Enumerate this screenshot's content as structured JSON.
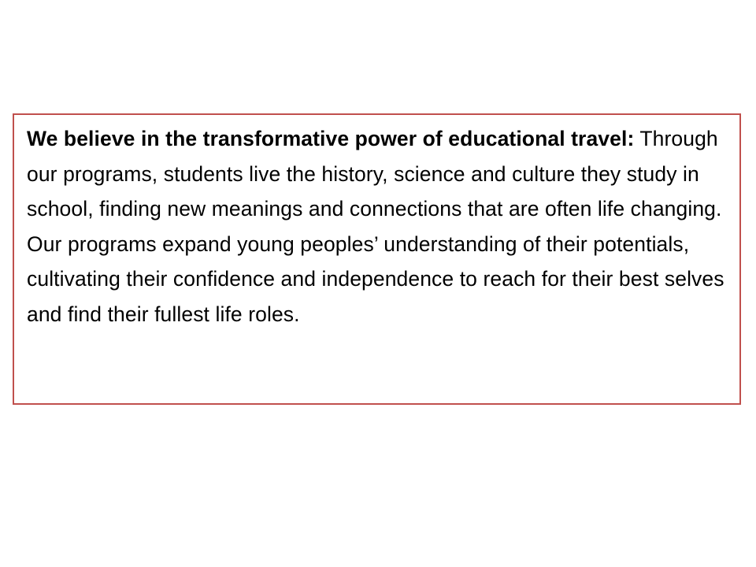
{
  "mission": {
    "lead_text": "We believe in the transformative power of educational travel:",
    "body_text": " Through our programs, students live the history, science and culture they study in school, finding new meanings and connections that are often life changing. Our programs expand young peoples’ understanding of their potentials, cultivating their confidence and independence to reach for their best selves and find their fullest life roles."
  },
  "colors": {
    "border": "#c0504d",
    "text": "#000000",
    "background": "#ffffff"
  }
}
